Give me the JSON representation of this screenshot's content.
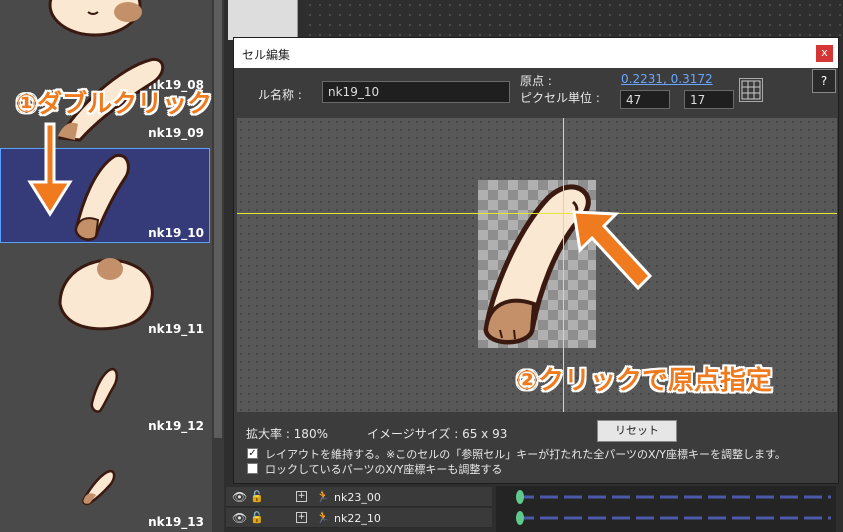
{
  "cell_list": {
    "items": [
      {
        "label": "nk19_08",
        "selected": false
      },
      {
        "label": "nk19_09",
        "selected": false
      },
      {
        "label": "nk19_10",
        "selected": true
      },
      {
        "label": "nk19_11",
        "selected": false
      },
      {
        "label": "nk19_12",
        "selected": false
      },
      {
        "label": "nk19_13",
        "selected": false
      }
    ]
  },
  "dialog": {
    "title": "セル編集",
    "close_label": "x",
    "cell_name_label": "ル名称 :",
    "cell_name_value": "nk19_10",
    "origin_label": "原点 :",
    "origin_value": "0.2231, 0.3172",
    "pixel_unit_label": "ピクセル単位 :",
    "pixel_x": "47",
    "pixel_y": "17",
    "help_label": "?",
    "zoom_text": "拡大率 : 180%",
    "image_size_text": "イメージサイズ : 65 x 93",
    "reset_label": "リセット",
    "option1_checked": true,
    "option1_label": "レイアウトを維持する。※このセルの「参照セル」キーが打たれた全パーツのX/Y座標キーを調整します。",
    "option2_checked": false,
    "option2_label": "ロックしているパーツのX/Y座標キーも調整する"
  },
  "layers": [
    {
      "name": "nk23_00"
    },
    {
      "name": "nk22_10"
    }
  ],
  "annotations": {
    "step1": "①ダブルクリック",
    "step2": "②クリックで原点指定",
    "color": "#f07a1e"
  },
  "colors": {
    "selection": "#353a78",
    "crosshair": "#e5e533",
    "close_button": "#d43636",
    "link": "#6aa6ff"
  }
}
